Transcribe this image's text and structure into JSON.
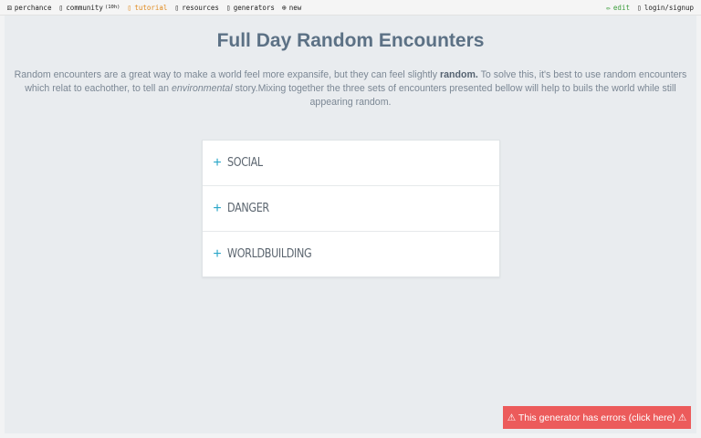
{
  "topbar": {
    "items": [
      {
        "icon": "dice-icon",
        "glyph": "⚄",
        "label": "perchance"
      },
      {
        "icon": "community-icon",
        "glyph": "▯",
        "label": "community",
        "count": "(10h)"
      },
      {
        "icon": "tutorial-icon",
        "glyph": "▯",
        "label": "tutorial"
      },
      {
        "icon": "resources-icon",
        "glyph": "▯",
        "label": "resources"
      },
      {
        "icon": "generators-icon",
        "glyph": "▯",
        "label": "generators"
      },
      {
        "icon": "new-icon",
        "glyph": "⊕",
        "label": "new"
      }
    ],
    "edit": {
      "glyph": "✏",
      "label": "edit"
    },
    "login": {
      "glyph": "▯",
      "label": "login/signup"
    }
  },
  "page": {
    "title": "Full Day Random Encounters",
    "desc_part1": "Random encounters are a great way to make a world feel more expansife, but they can feel slightly ",
    "desc_bold": "random.",
    "desc_part2": " To solve this, it's best to use random encounters which relat to eachother, to tell an ",
    "desc_italic": "environmental",
    "desc_part3": " story.Mixing together the three sets of encounters presented bellow will help to buils the world while still appearing random."
  },
  "accordion": [
    {
      "label": "SOCIAL"
    },
    {
      "label": "DANGER"
    },
    {
      "label": "WORLDBUILDING"
    }
  ],
  "error": {
    "label": "⚠ This generator has errors (click here) ⚠"
  },
  "colors": {
    "accent": "#2aa6c8",
    "title": "#5c7185",
    "error": "#ec5b5b",
    "tutorial": "#e08a1e",
    "edit": "#3c9d3c"
  }
}
